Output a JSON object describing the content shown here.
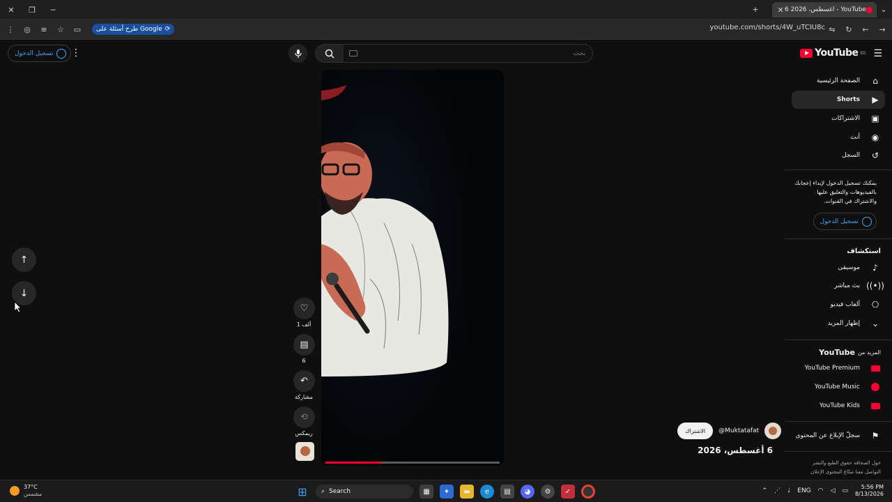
{
  "browser": {
    "tab_title": "6 أغسطس، 2026 - YouTube",
    "url": "youtube.com/shorts/4W_uTCIU8c",
    "google_pill": "طرح أسئلة على Google"
  },
  "masthead": {
    "logo_text": "YouTube",
    "country_code": "EG",
    "search_placeholder": "بحث",
    "signin_label": "تسجيل الدخول"
  },
  "sidebar": {
    "items": [
      {
        "label": "الصفحة الرئيسية",
        "icon": "home-icon"
      },
      {
        "label": "Shorts",
        "icon": "shorts-icon"
      },
      {
        "label": "الاشتراكات",
        "icon": "subscriptions-icon"
      },
      {
        "label": "أنت",
        "icon": "you-icon"
      },
      {
        "label": "السجل",
        "icon": "history-icon"
      }
    ],
    "signin_prompt": "يمكنك تسجيل الدخول لإبداء إعجابك بالفيديوهات والتعليق عليها والاشتراك في القنوات.",
    "signin_button": "تسجيل الدخول",
    "explore_title": "استكشاف",
    "explore_items": [
      {
        "label": "موسيقى",
        "icon": "music-icon"
      },
      {
        "label": "بث مباشر",
        "icon": "live-icon"
      },
      {
        "label": "ألعاب فيديو",
        "icon": "gaming-icon"
      },
      {
        "label": "إظهار المزيد",
        "icon": "chevron-down-icon"
      }
    ],
    "more_title_prefix": "المزيد من",
    "more_title_brand": "YouTube",
    "more_items": [
      {
        "label": "YouTube Premium"
      },
      {
        "label": "YouTube Music"
      },
      {
        "label": "YouTube Kids"
      }
    ],
    "report_label": "سجلّ الإبلاغ عن المحتوى",
    "footer_line1": "حول  الصحافة  حقوق الطبع والنشر",
    "footer_line2": "التواصل معنا  صنّاع المحتوى  الإعلان"
  },
  "short": {
    "like_count": "1 ألف",
    "comment_count": "6",
    "share_label": "مشاركة",
    "remix_label": "ريمكس",
    "progress": 0.32
  },
  "channel": {
    "handle": "@Muktatafat",
    "subscribe_label": "الاشتراك",
    "date": "6 أغسطس، 2026"
  },
  "taskbar": {
    "weather_temp": "37°C",
    "weather_desc": "مشمس",
    "search_label": "Search",
    "lang": "ENG",
    "time": "5:56 PM",
    "date": "8/13/2026"
  },
  "colors": {
    "accent_blue": "#3ea6ff",
    "youtube_red": "#ff0033",
    "background": "#0f0f0f"
  }
}
